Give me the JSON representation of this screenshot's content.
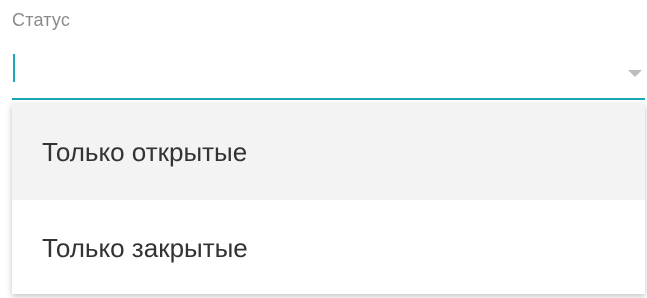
{
  "field": {
    "label": "Статус",
    "value": ""
  },
  "dropdown": {
    "options": [
      {
        "label": "Только открытые",
        "highlighted": true
      },
      {
        "label": "Только закрытые",
        "highlighted": false
      }
    ]
  },
  "colors": {
    "accent": "#1aa6b7",
    "highlight": "#f3f3f3"
  }
}
